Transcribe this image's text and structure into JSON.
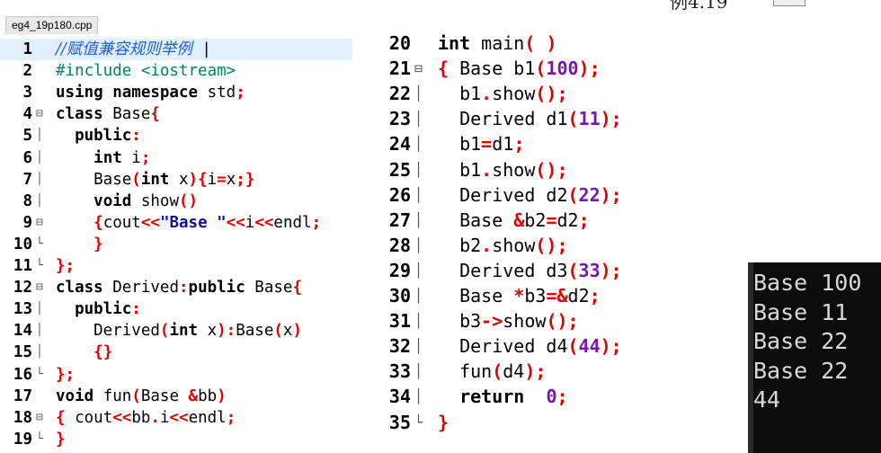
{
  "tab": {
    "filename": "eg4_19p180.cpp"
  },
  "top_fragment": {
    "text": "例4.19"
  },
  "left_editor": {
    "lines": [
      {
        "n": "1",
        "fold": "",
        "hl": true,
        "tokens": [
          [
            "c",
            "//赋值兼容规则举例"
          ],
          [
            "x",
            " |"
          ]
        ]
      },
      {
        "n": "2",
        "fold": "",
        "tokens": [
          [
            "i",
            "#include <iostream>"
          ]
        ]
      },
      {
        "n": "3",
        "fold": "",
        "tokens": [
          [
            "k",
            "using namespace"
          ],
          [
            "x",
            " std"
          ],
          [
            "p",
            ";"
          ]
        ]
      },
      {
        "n": "4",
        "fold": "⊟",
        "tokens": [
          [
            "k",
            "class"
          ],
          [
            "x",
            " Base"
          ],
          [
            "p",
            "{"
          ]
        ]
      },
      {
        "n": "5",
        "fold": "│",
        "tokens": [
          [
            "x",
            "  "
          ],
          [
            "k",
            "public"
          ],
          [
            "p",
            ":"
          ]
        ]
      },
      {
        "n": "6",
        "fold": "│",
        "tokens": [
          [
            "x",
            "    "
          ],
          [
            "k",
            "int"
          ],
          [
            "x",
            " i"
          ],
          [
            "p",
            ";"
          ]
        ]
      },
      {
        "n": "7",
        "fold": "│",
        "tokens": [
          [
            "x",
            "    Base"
          ],
          [
            "p",
            "("
          ],
          [
            "k",
            "int"
          ],
          [
            "x",
            " x"
          ],
          [
            "p",
            ")"
          ],
          [
            "p",
            "{"
          ],
          [
            "x",
            "i"
          ],
          [
            "p",
            "="
          ],
          [
            "x",
            "x"
          ],
          [
            "p",
            ";"
          ],
          [
            "p",
            "}"
          ]
        ]
      },
      {
        "n": "8",
        "fold": "│",
        "tokens": [
          [
            "x",
            "    "
          ],
          [
            "k",
            "void"
          ],
          [
            "x",
            " show"
          ],
          [
            "p",
            "()"
          ]
        ]
      },
      {
        "n": "9",
        "fold": "⊟",
        "tokens": [
          [
            "x",
            "    "
          ],
          [
            "p",
            "{"
          ],
          [
            "x",
            "cout"
          ],
          [
            "p",
            "<<"
          ],
          [
            "s",
            "\"Base \""
          ],
          [
            "p",
            "<<"
          ],
          [
            "x",
            "i"
          ],
          [
            "p",
            "<<"
          ],
          [
            "x",
            "endl"
          ],
          [
            "p",
            ";"
          ]
        ]
      },
      {
        "n": "10",
        "fold": "└",
        "tokens": [
          [
            "x",
            "    "
          ],
          [
            "p",
            "}"
          ]
        ]
      },
      {
        "n": "11",
        "fold": "└",
        "tokens": [
          [
            "p",
            "};"
          ]
        ]
      },
      {
        "n": "12",
        "fold": "⊟",
        "tokens": [
          [
            "k",
            "class"
          ],
          [
            "x",
            " Derived"
          ],
          [
            "p",
            ":"
          ],
          [
            "k",
            "public"
          ],
          [
            "x",
            " Base"
          ],
          [
            "p",
            "{"
          ]
        ]
      },
      {
        "n": "13",
        "fold": "│",
        "tokens": [
          [
            "x",
            "  "
          ],
          [
            "k",
            "public"
          ],
          [
            "p",
            ":"
          ]
        ]
      },
      {
        "n": "14",
        "fold": "│",
        "tokens": [
          [
            "x",
            "    Derived"
          ],
          [
            "p",
            "("
          ],
          [
            "k",
            "int"
          ],
          [
            "x",
            " x"
          ],
          [
            "p",
            "):"
          ],
          [
            "x",
            "Base"
          ],
          [
            "p",
            "("
          ],
          [
            "x",
            "x"
          ],
          [
            "p",
            ")"
          ]
        ]
      },
      {
        "n": "15",
        "fold": "│",
        "tokens": [
          [
            "x",
            "    "
          ],
          [
            "p",
            "{}"
          ]
        ]
      },
      {
        "n": "16",
        "fold": "└",
        "tokens": [
          [
            "p",
            "};"
          ]
        ]
      },
      {
        "n": "17",
        "fold": "",
        "tokens": [
          [
            "k",
            "void"
          ],
          [
            "x",
            " fun"
          ],
          [
            "p",
            "("
          ],
          [
            "x",
            "Base "
          ],
          [
            "p",
            "&"
          ],
          [
            "x",
            "bb"
          ],
          [
            "p",
            ")"
          ]
        ]
      },
      {
        "n": "18",
        "fold": "⊟",
        "tokens": [
          [
            "p",
            "{"
          ],
          [
            "x",
            " cout"
          ],
          [
            "p",
            "<<"
          ],
          [
            "x",
            "bb"
          ],
          [
            "p",
            "."
          ],
          [
            "x",
            "i"
          ],
          [
            "p",
            "<<"
          ],
          [
            "x",
            "endl"
          ],
          [
            "p",
            ";"
          ]
        ]
      },
      {
        "n": "19",
        "fold": "└",
        "tokens": [
          [
            "p",
            "}"
          ]
        ]
      }
    ]
  },
  "right_editor": {
    "lines": [
      {
        "n": "20",
        "fold": "",
        "tokens": [
          [
            "k",
            "int"
          ],
          [
            "x",
            " main"
          ],
          [
            "p",
            "("
          ],
          [
            "x",
            " "
          ],
          [
            "p",
            ")"
          ]
        ]
      },
      {
        "n": "21",
        "fold": "⊟",
        "tokens": [
          [
            "p",
            "{"
          ],
          [
            "x",
            " Base b1"
          ],
          [
            "p",
            "("
          ],
          [
            "n",
            "100"
          ],
          [
            "p",
            ");"
          ]
        ]
      },
      {
        "n": "22",
        "fold": "│",
        "tokens": [
          [
            "x",
            "  b1"
          ],
          [
            "p",
            "."
          ],
          [
            "x",
            "show"
          ],
          [
            "p",
            "();"
          ]
        ]
      },
      {
        "n": "23",
        "fold": "│",
        "tokens": [
          [
            "x",
            "  Derived d1"
          ],
          [
            "p",
            "("
          ],
          [
            "n",
            "11"
          ],
          [
            "p",
            ");"
          ]
        ]
      },
      {
        "n": "24",
        "fold": "│",
        "tokens": [
          [
            "x",
            "  b1"
          ],
          [
            "p",
            "="
          ],
          [
            "x",
            "d1"
          ],
          [
            "p",
            ";"
          ]
        ]
      },
      {
        "n": "25",
        "fold": "│",
        "tokens": [
          [
            "x",
            "  b1"
          ],
          [
            "p",
            "."
          ],
          [
            "x",
            "show"
          ],
          [
            "p",
            "();"
          ]
        ]
      },
      {
        "n": "26",
        "fold": "│",
        "tokens": [
          [
            "x",
            "  Derived d2"
          ],
          [
            "p",
            "("
          ],
          [
            "n",
            "22"
          ],
          [
            "p",
            ");"
          ]
        ]
      },
      {
        "n": "27",
        "fold": "│",
        "tokens": [
          [
            "x",
            "  Base "
          ],
          [
            "p",
            "&"
          ],
          [
            "x",
            "b2"
          ],
          [
            "p",
            "="
          ],
          [
            "x",
            "d2"
          ],
          [
            "p",
            ";"
          ]
        ]
      },
      {
        "n": "28",
        "fold": "│",
        "tokens": [
          [
            "x",
            "  b2"
          ],
          [
            "p",
            "."
          ],
          [
            "x",
            "show"
          ],
          [
            "p",
            "();"
          ]
        ]
      },
      {
        "n": "29",
        "fold": "│",
        "tokens": [
          [
            "x",
            "  Derived d3"
          ],
          [
            "p",
            "("
          ],
          [
            "n",
            "33"
          ],
          [
            "p",
            ");"
          ]
        ]
      },
      {
        "n": "30",
        "fold": "│",
        "tokens": [
          [
            "x",
            "  Base "
          ],
          [
            "p",
            "*"
          ],
          [
            "x",
            "b3"
          ],
          [
            "p",
            "=&"
          ],
          [
            "x",
            "d2"
          ],
          [
            "p",
            ";"
          ]
        ]
      },
      {
        "n": "31",
        "fold": "│",
        "tokens": [
          [
            "x",
            "  b3"
          ],
          [
            "p",
            "->"
          ],
          [
            "x",
            "show"
          ],
          [
            "p",
            "();"
          ]
        ]
      },
      {
        "n": "32",
        "fold": "│",
        "tokens": [
          [
            "x",
            "  Derived d4"
          ],
          [
            "p",
            "("
          ],
          [
            "n",
            "44"
          ],
          [
            "p",
            ");"
          ]
        ]
      },
      {
        "n": "33",
        "fold": "│",
        "tokens": [
          [
            "x",
            "  fun"
          ],
          [
            "p",
            "("
          ],
          [
            "x",
            "d4"
          ],
          [
            "p",
            ");"
          ]
        ]
      },
      {
        "n": "34",
        "fold": "│",
        "tokens": [
          [
            "x",
            "  "
          ],
          [
            "k",
            "return"
          ],
          [
            "x",
            "  "
          ],
          [
            "n",
            "0"
          ],
          [
            "p",
            ";"
          ]
        ]
      },
      {
        "n": "35",
        "fold": "└",
        "tokens": [
          [
            "p",
            "}"
          ]
        ]
      }
    ]
  },
  "console": {
    "lines": [
      "Base 100",
      "Base 11",
      "Base 22",
      "Base 22",
      "44"
    ]
  }
}
